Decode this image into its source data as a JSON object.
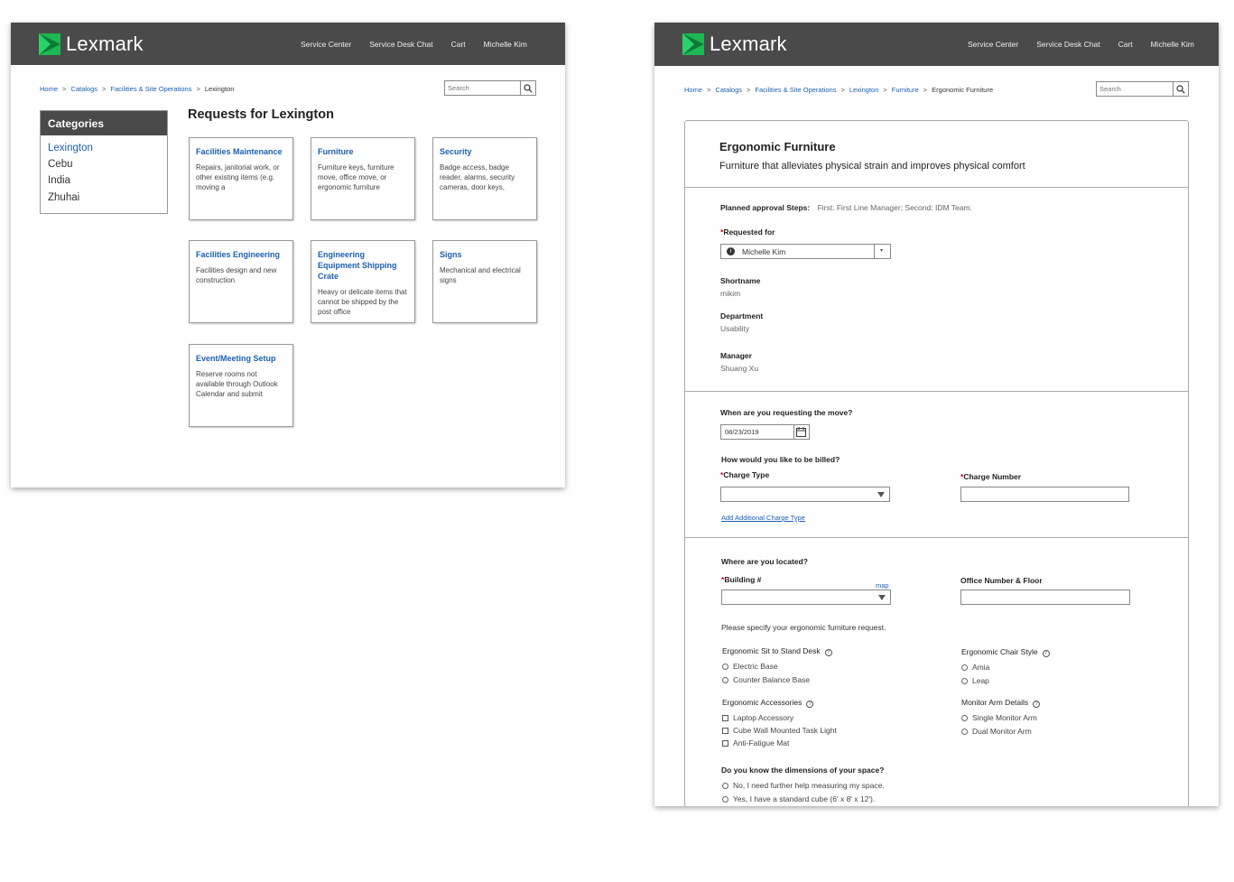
{
  "brand": {
    "name": "Lexmark",
    "green": "#1db954",
    "topbar_color": "#4a4a4a",
    "link_color": "#1a5fb4"
  },
  "nav": [
    "Service Center",
    "Service Desk Chat",
    "Cart",
    "Michelle Kim"
  ],
  "search": {
    "placeholder": "Search",
    "icon": "search-icon"
  },
  "page1": {
    "breadcrumb": [
      "Home",
      "Catalogs",
      "Facilities & Site Operations",
      "Lexington"
    ],
    "categories": {
      "title": "Categories",
      "items": [
        "Lexington",
        "Cebu",
        "India",
        "Zhuhai"
      ],
      "active": "Lexington"
    },
    "heading": "Requests for Lexington",
    "cards": [
      {
        "title": "Facilities Maintenance",
        "desc": "Repairs, janitorial work, or other existing items (e.g. moving a"
      },
      {
        "title": "Furniture",
        "desc": "Furniture keys, furniture move, office move, or ergonomic furniture"
      },
      {
        "title": "Security",
        "desc": "Badge access, badge reader, alarms, security cameras, door keys,"
      },
      {
        "title": "Facilities Engineering",
        "desc": "Facilities design and new construction"
      },
      {
        "title": "Engineering Equipment Shipping Crate",
        "desc": "Heavy or delicate items that cannot be shipped by the post office"
      },
      {
        "title": "Signs",
        "desc": "Mechanical and electrical signs"
      },
      {
        "title": "Event/Meeting Setup",
        "desc": "Reserve rooms not available through Outlook Calendar and submit"
      }
    ]
  },
  "page2": {
    "breadcrumb": [
      "Home",
      "Catalogs",
      "Facilities & Site Operations",
      "Lexington",
      "Furniture",
      "Ergonomic Furniture"
    ],
    "title": "Ergonomic Furniture",
    "subtitle": "Furniture that alleviates physical strain and improves physical comfort",
    "approval": {
      "label": "Planned approval Steps:",
      "value": "First: First Line Manager; Second: IDM Team."
    },
    "requested_for": {
      "label": "Requested for",
      "value": "Michelle Kim"
    },
    "shortname": {
      "label": "Shortname",
      "value": "mikim"
    },
    "department": {
      "label": "Department",
      "value": "Usability"
    },
    "manager": {
      "label": "Manager",
      "value": "Shuang Xu"
    },
    "move_q": "When are you requesting the move?",
    "move_date": "08/23/2019",
    "billing_q": "How would you like to be billed?",
    "charge_type": {
      "label": "Charge Type",
      "value": ""
    },
    "charge_number": {
      "label": "Charge Number",
      "value": ""
    },
    "add_charge": "Add Additional Charge Type",
    "location_q": "Where are you located?",
    "building": {
      "label": "Building #",
      "map": "map",
      "value": ""
    },
    "office": {
      "label": "Office Number & Floor",
      "value": ""
    },
    "specify": "Please specify your ergonomic furniture request.",
    "sit_stand": {
      "label": "Ergonomic Sit to Stand Desk",
      "options": [
        "Electric Base",
        "Counter Balance Base"
      ]
    },
    "chair": {
      "label": "Ergonomic Chair Style",
      "options": [
        "Amia",
        "Leap"
      ]
    },
    "accessories": {
      "label": "Ergonomic Accessories",
      "options": [
        "Laptop Accessory",
        "Cube Wall Mounted Task Light",
        "Anti-Fatigue Mat"
      ]
    },
    "monitor": {
      "label": "Monitor Arm Details",
      "options": [
        "Single Monitor Arm",
        "Dual Monitor Arm"
      ]
    },
    "dimensions": {
      "label": "Do you know the dimensions of your space?",
      "options": [
        "No, I need further help measuring my space.",
        "Yes, I have a standard cube (6' x 8' x 12')."
      ]
    }
  }
}
